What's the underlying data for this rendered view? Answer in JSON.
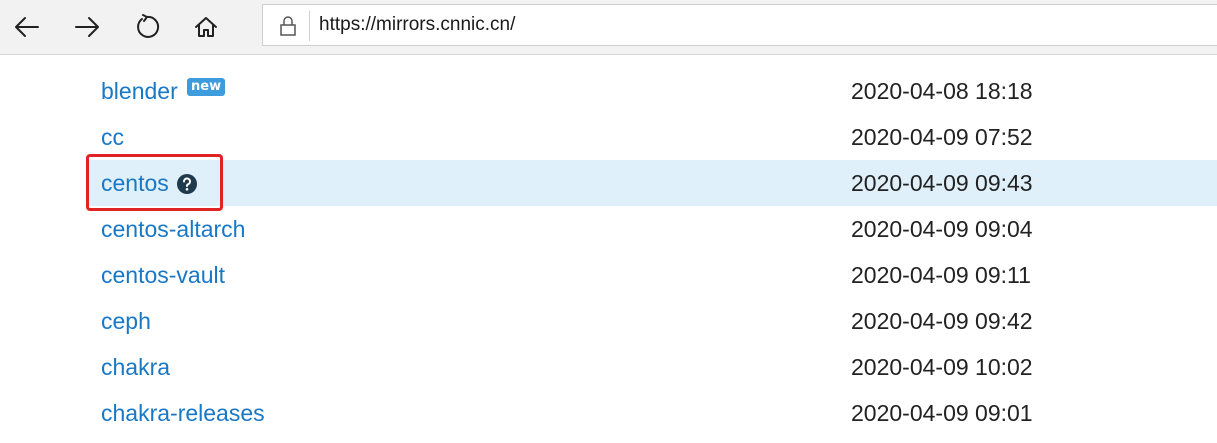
{
  "browser": {
    "url": "https://mirrors.cnnic.cn/",
    "buttons": {
      "back": "back-arrow-icon",
      "forward": "forward-arrow-icon",
      "refresh": "refresh-icon",
      "home": "home-icon"
    },
    "lock_icon": "lock-icon"
  },
  "listing": {
    "rows": [
      {
        "name": "blender",
        "date": "2020-04-08 18:18",
        "badge": "new"
      },
      {
        "name": "cc",
        "date": "2020-04-09 07:52"
      },
      {
        "name": "centos",
        "date": "2020-04-09 09:43",
        "icon": "help-circle-icon",
        "highlighted": true
      },
      {
        "name": "centos-altarch",
        "date": "2020-04-09 09:04"
      },
      {
        "name": "centos-vault",
        "date": "2020-04-09 09:11"
      },
      {
        "name": "ceph",
        "date": "2020-04-09 09:42"
      },
      {
        "name": "chakra",
        "date": "2020-04-09 10:02"
      },
      {
        "name": "chakra-releases",
        "date": "2020-04-09 09:01"
      }
    ]
  },
  "colors": {
    "link": "#1878c6",
    "highlight_row": "#dff0fa",
    "annotation_box": "#e02424",
    "badge": "#3c9cdc"
  }
}
